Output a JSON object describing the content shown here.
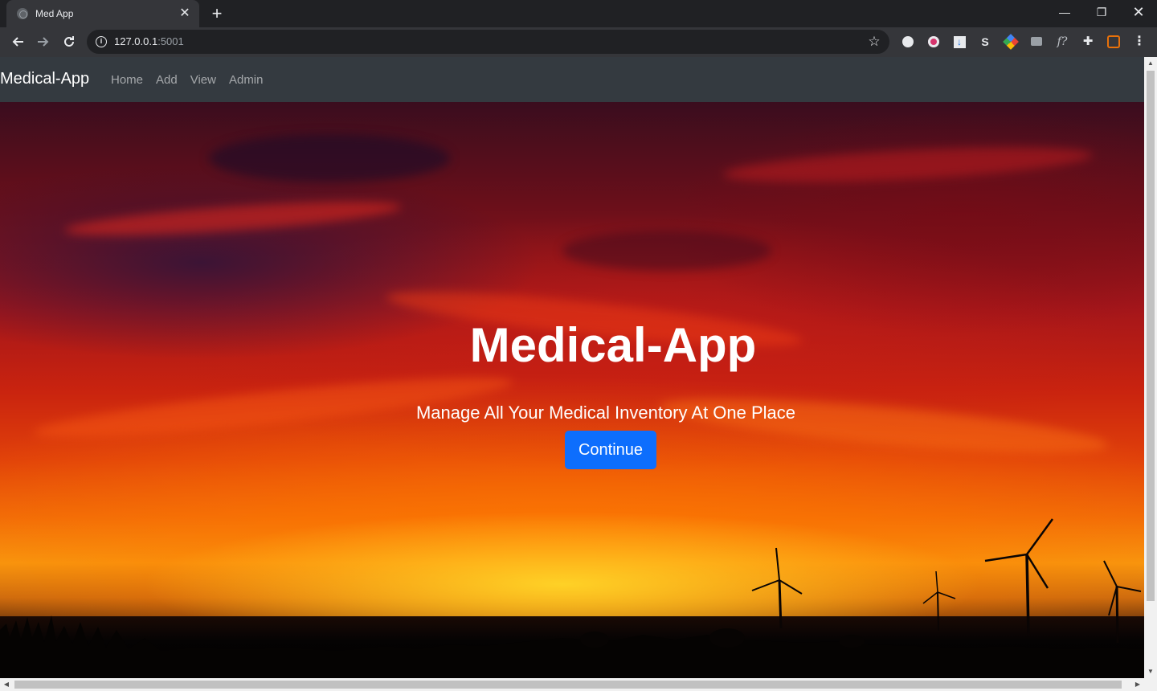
{
  "browser": {
    "tab_title": "Med App",
    "tab_close": "✕",
    "new_tab": "+",
    "window_minimize": "—",
    "window_restore": "❐",
    "window_close": "✕",
    "url_host": "127.0.0.1",
    "url_port": ":5001",
    "extensions": [
      "extension-icon-1",
      "extension-icon-2",
      "extension-download-icon",
      "extension-s-icon",
      "extension-color-icon",
      "extension-camera-icon",
      "extension-f-icon",
      "extensions-puzzle-icon",
      "extension-profile-icon",
      "menu-kebab-icon"
    ],
    "ext_s_label": "S",
    "ext_f_label": "f?"
  },
  "navbar": {
    "brand": "Medical-App",
    "links": [
      {
        "label": "Home"
      },
      {
        "label": "Add"
      },
      {
        "label": "View"
      },
      {
        "label": "Admin"
      }
    ]
  },
  "hero": {
    "title": "Medical-App",
    "subtitle": "Manage All Your Medical Inventory At One Place",
    "button_label": "Continue"
  },
  "colors": {
    "navbar_bg": "#343a40",
    "button_bg": "#0d6efd",
    "chrome_bg": "#202124",
    "toolbar_bg": "#35363a"
  }
}
